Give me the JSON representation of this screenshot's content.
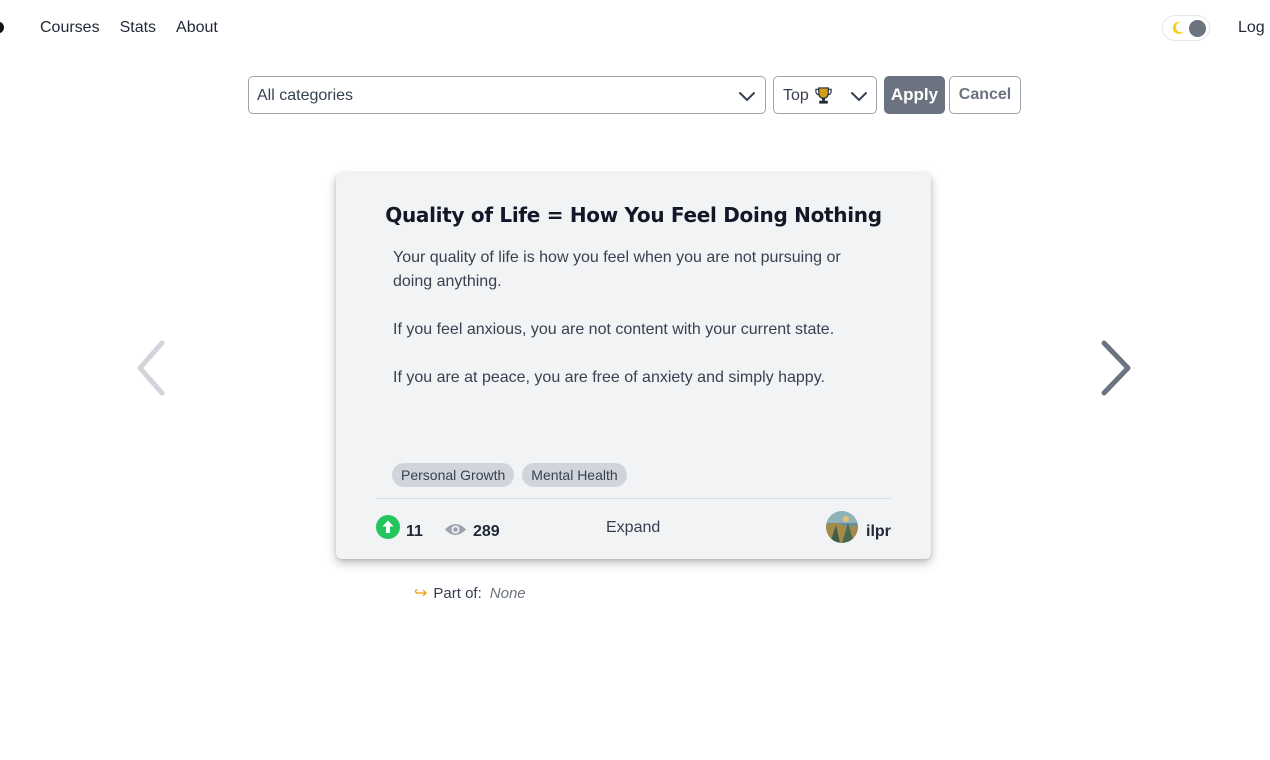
{
  "nav": {
    "links": [
      {
        "label": "Courses"
      },
      {
        "label": "Stats"
      },
      {
        "label": "About"
      }
    ],
    "login_label": "Log"
  },
  "filter": {
    "category_value": "All categories",
    "sort_value": "Top",
    "apply_label": "Apply",
    "cancel_label": "Cancel"
  },
  "card": {
    "title": "Quality of Life = How You Feel Doing Nothing",
    "paragraphs": [
      "Your quality of life is how you feel when you are not pursuing or doing anything.",
      "If you feel anxious, you are not content with your current state.",
      "If you are at peace, you are free of anxiety and simply happy."
    ],
    "tags": [
      "Personal Growth",
      "Mental Health"
    ],
    "upvotes": "11",
    "views": "289",
    "expand_label": "Expand",
    "author": "ilpr"
  },
  "part_of": {
    "label": "Part of:",
    "value": "None"
  },
  "colors": {
    "upvote_green": "#22c55e",
    "accent_orange": "#f59e0b",
    "moon_yellow": "#facc15",
    "apply_bg": "#6b7280"
  }
}
